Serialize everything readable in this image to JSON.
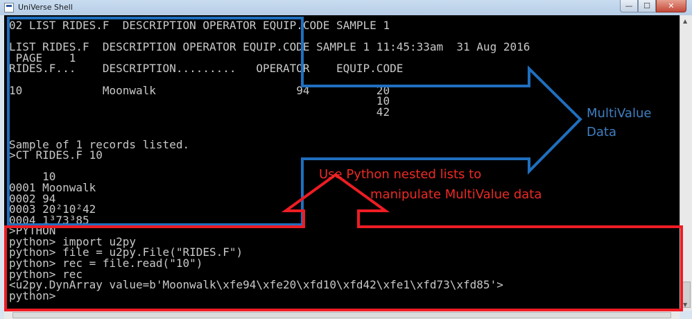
{
  "window": {
    "title": "UniVerse Shell",
    "buttons": {
      "minimize": "—",
      "maximize": "☐",
      "close": "✕"
    }
  },
  "console": {
    "lines": [
      "02 LIST RIDES.F  DESCRIPTION OPERATOR EQUIP.CODE SAMPLE 1",
      "",
      "LIST RIDES.F  DESCRIPTION OPERATOR EQUIP.CODE SAMPLE 1 11:45:33am  31 Aug 2016",
      " PAGE    1",
      "RIDES.F...    DESCRIPTION.........   OPERATOR    EQUIP.CODE",
      "",
      "10            Moonwalk                     94          20",
      "                                                       10",
      "                                                       42",
      "",
      "",
      "Sample of 1 records listed.",
      ">CT RIDES.F 10",
      "",
      "     10",
      "0001 Moonwalk",
      "0002 94",
      "0003 20²10²42",
      "0004 1³73³85",
      ">PYTHON",
      "python> import u2py",
      "python> file = u2py.File(\"RIDES.F\")",
      "python> rec = file.read(\"10\")",
      "python> rec",
      "<u2py.DynArray value=b'Moonwalk\\xfe94\\xfe20\\xfd10\\xfd42\\xfe1\\xfd73\\xfd85'>",
      "python>"
    ]
  },
  "annotations": {
    "multivalue_line1": "MultiValue",
    "multivalue_line2": "Data",
    "python_line1": "Use Python nested lists to",
    "python_line2": "manipulate MultiValue data"
  },
  "colors": {
    "blue": "#1f6fbe",
    "red": "#ee1c24",
    "console_bg": "#000000",
    "console_text": "#c8c8c8"
  }
}
